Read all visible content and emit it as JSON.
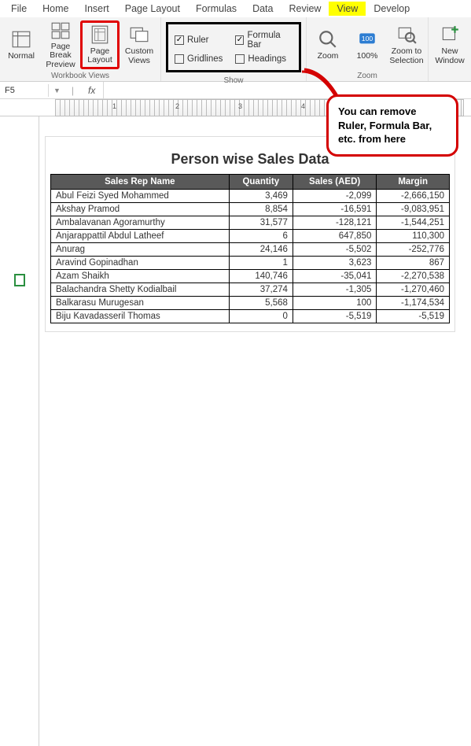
{
  "menu": {
    "file": "File",
    "home": "Home",
    "insert": "Insert",
    "pagelayout": "Page Layout",
    "formulas": "Formulas",
    "data": "Data",
    "review": "Review",
    "view": "View",
    "developer": "Develop"
  },
  "ribbon": {
    "workbook_views_label": "Workbook Views",
    "normal": "Normal",
    "pagebreak": "Page Break Preview",
    "pagelayout": "Page Layout",
    "custom": "Custom Views",
    "show_label": "Show",
    "ruler": "Ruler",
    "formula_bar": "Formula Bar",
    "gridlines": "Gridlines",
    "headings": "Headings",
    "zoom_label": "Zoom",
    "zoom": "Zoom",
    "z100": "100%",
    "zoom_sel": "Zoom to Selection",
    "new_window": "New Window"
  },
  "namebox": "F5",
  "callout": "You can remove Ruler, Formula Bar, etc. from here",
  "chart_data": {
    "type": "table",
    "title": "Person wise Sales Data",
    "headers": [
      "Sales Rep Name",
      "Quantity",
      "Sales (AED)",
      "Margin"
    ],
    "rows": [
      [
        "Abul Feizi Syed Mohammed",
        "3,469",
        "-2,099",
        "-2,666,150"
      ],
      [
        "Akshay Pramod",
        "8,854",
        "-16,591",
        "-9,083,951"
      ],
      [
        "Ambalavanan Agoramurthy",
        "31,577",
        "-128,121",
        "-1,544,251"
      ],
      [
        "Anjarappattil Abdul Latheef",
        "6",
        "647,850",
        "110,300"
      ],
      [
        "Anurag",
        "24,146",
        "-5,502",
        "-252,776"
      ],
      [
        "Aravind Gopinadhan",
        "1",
        "3,623",
        "867"
      ],
      [
        "Azam Shaikh",
        "140,746",
        "-35,041",
        "-2,270,538"
      ],
      [
        "Balachandra Shetty Kodialbail",
        "37,274",
        "-1,305",
        "-1,270,460"
      ],
      [
        "Balkarasu Murugesan",
        "5,568",
        "100",
        "-1,174,534"
      ],
      [
        "Biju Kavadasseril Thomas",
        "0",
        "-5,519",
        "-5,519"
      ]
    ]
  }
}
